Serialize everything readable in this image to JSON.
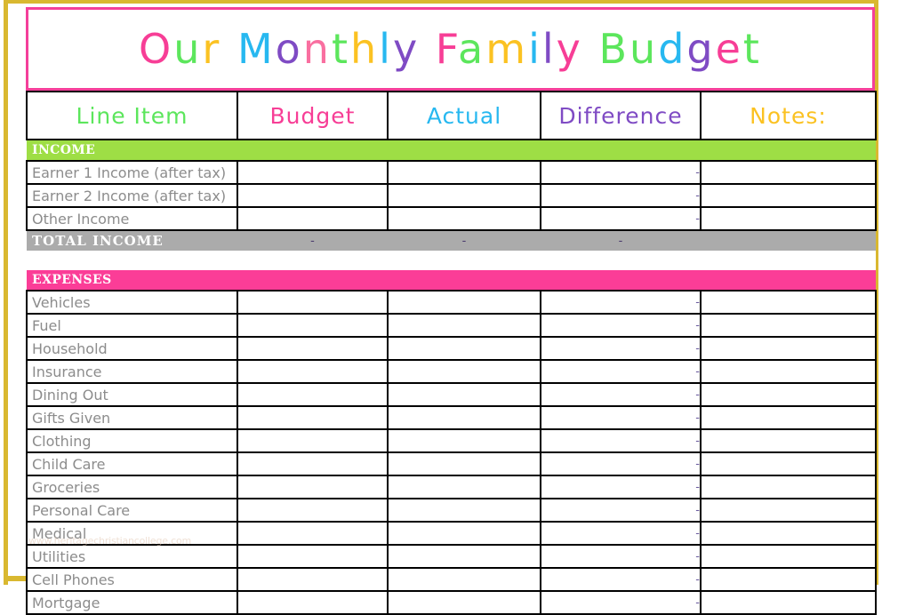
{
  "document": {
    "title": "Our Monthly Family Budget",
    "title_letters": [
      {
        "ch": "O",
        "color": "#F73E96"
      },
      {
        "ch": "u",
        "color": "#5CE65C"
      },
      {
        "ch": "r",
        "color": "#FBC222"
      },
      {
        "ch": " ",
        "color": "#FFFFFF"
      },
      {
        "ch": "M",
        "color": "#27B8F0"
      },
      {
        "ch": "o",
        "color": "#7F4BC4"
      },
      {
        "ch": "n",
        "color": "#F96FA0"
      },
      {
        "ch": "t",
        "color": "#5CE65C"
      },
      {
        "ch": "h",
        "color": "#FBC222"
      },
      {
        "ch": "l",
        "color": "#27B8F0"
      },
      {
        "ch": "y",
        "color": "#7F4BC4"
      },
      {
        "ch": " ",
        "color": "#FFFFFF"
      },
      {
        "ch": "F",
        "color": "#F73E96"
      },
      {
        "ch": "a",
        "color": "#5CE65C"
      },
      {
        "ch": "m",
        "color": "#FBC222"
      },
      {
        "ch": "i",
        "color": "#27B8F0"
      },
      {
        "ch": "l",
        "color": "#7F4BC4"
      },
      {
        "ch": "y",
        "color": "#F73E96"
      },
      {
        "ch": " ",
        "color": "#FFFFFF"
      },
      {
        "ch": "B",
        "color": "#5CE65C"
      },
      {
        "ch": "u",
        "color": "#5CE65C"
      },
      {
        "ch": "d",
        "color": "#27B8F0"
      },
      {
        "ch": "g",
        "color": "#7F4BC4"
      },
      {
        "ch": "e",
        "color": "#F73E96"
      },
      {
        "ch": "t",
        "color": "#5CE65C"
      }
    ],
    "watermark": "www.heritagechristiancollege.com"
  },
  "colors": {
    "frame_gold": "#D9B830",
    "title_border_pink": "#F43F9A",
    "income_band_green": "#9EDE45",
    "expenses_band_pink": "#FB3D97",
    "total_row_gray": "#ABABAB",
    "row_label_gray": "#8C8C8C",
    "dash_purple": "#6B5B9E"
  },
  "table": {
    "columns": [
      {
        "key": "line_item",
        "label": "Line Item",
        "color": "#5CE65C"
      },
      {
        "key": "budget",
        "label": "Budget",
        "color": "#F73E96"
      },
      {
        "key": "actual",
        "label": "Actual",
        "color": "#27B8F0"
      },
      {
        "key": "difference",
        "label": "Difference",
        "color": "#7F4BC4"
      },
      {
        "key": "notes",
        "label": "Notes:",
        "color": "#FBC222"
      }
    ],
    "sections": [
      {
        "band_label": "INCOME",
        "band_style": "income",
        "rows": [
          {
            "label": "Earner 1 Income (after tax)",
            "budget": "",
            "actual": "",
            "difference": "-",
            "notes": ""
          },
          {
            "label": "Earner 2 Income (after tax)",
            "budget": "",
            "actual": "",
            "difference": "-",
            "notes": ""
          },
          {
            "label": "Other Income",
            "budget": "",
            "actual": "",
            "difference": "-",
            "notes": ""
          }
        ],
        "total": {
          "label": "TOTAL  INCOME",
          "budget": "-",
          "actual": "-",
          "difference": "-"
        }
      },
      {
        "band_label": "EXPENSES",
        "band_style": "expenses",
        "rows": [
          {
            "label": "Vehicles",
            "budget": "",
            "actual": "",
            "difference": "-",
            "notes": ""
          },
          {
            "label": "Fuel",
            "budget": "",
            "actual": "",
            "difference": "-",
            "notes": ""
          },
          {
            "label": "Household",
            "budget": "",
            "actual": "",
            "difference": "-",
            "notes": ""
          },
          {
            "label": "Insurance",
            "budget": "",
            "actual": "",
            "difference": "-",
            "notes": ""
          },
          {
            "label": "Dining Out",
            "budget": "",
            "actual": "",
            "difference": "-",
            "notes": ""
          },
          {
            "label": "Gifts Given",
            "budget": "",
            "actual": "",
            "difference": "-",
            "notes": ""
          },
          {
            "label": "Clothing",
            "budget": "",
            "actual": "",
            "difference": "-",
            "notes": ""
          },
          {
            "label": "Child Care",
            "budget": "",
            "actual": "",
            "difference": "-",
            "notes": ""
          },
          {
            "label": "Groceries",
            "budget": "",
            "actual": "",
            "difference": "-",
            "notes": ""
          },
          {
            "label": "Personal Care",
            "budget": "",
            "actual": "",
            "difference": "-",
            "notes": ""
          },
          {
            "label": "Medical",
            "budget": "",
            "actual": "",
            "difference": "-",
            "notes": ""
          },
          {
            "label": "Utilities",
            "budget": "",
            "actual": "",
            "difference": "-",
            "notes": ""
          },
          {
            "label": "Cell Phones",
            "budget": "",
            "actual": "",
            "difference": "-",
            "notes": ""
          },
          {
            "label": "Mortgage",
            "budget": "",
            "actual": "",
            "difference": "-",
            "notes": ""
          }
        ],
        "total": null
      }
    ]
  }
}
